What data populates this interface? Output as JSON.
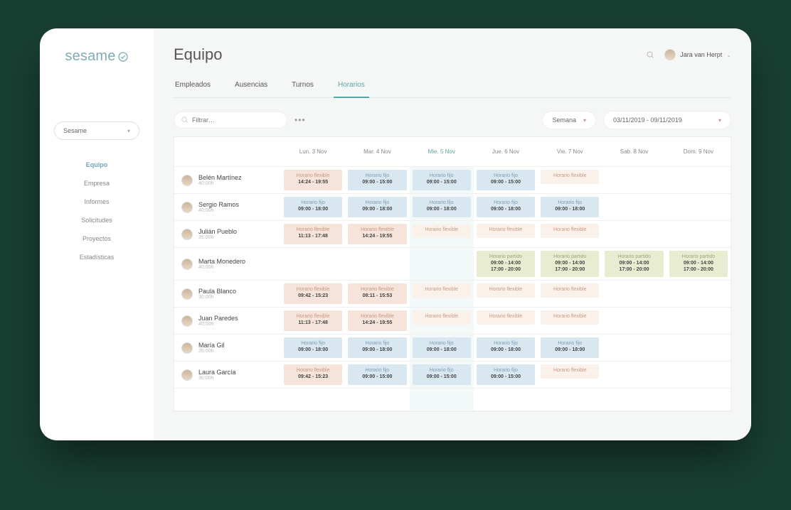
{
  "brand": "sesame",
  "org_select": {
    "label": "Sesame"
  },
  "nav": [
    {
      "label": "Equipo",
      "active": true
    },
    {
      "label": "Empresa"
    },
    {
      "label": "Informes"
    },
    {
      "label": "Solicitudes"
    },
    {
      "label": "Proyectos"
    },
    {
      "label": "Estadísticas"
    }
  ],
  "header": {
    "title": "Equipo",
    "user_name": "Jara van Herpt"
  },
  "tabs": [
    {
      "label": "Empleados"
    },
    {
      "label": "Ausencias"
    },
    {
      "label": "Turnos"
    },
    {
      "label": "Horarios",
      "active": true
    }
  ],
  "filter": {
    "placeholder": "Filtrar…"
  },
  "view_select": {
    "label": "Semana"
  },
  "date_range": {
    "label": "03/11/2019 - 09/11/2019"
  },
  "days": [
    {
      "label": "Lun. 3 Nov"
    },
    {
      "label": "Mar. 4 Nov"
    },
    {
      "label": "Mie. 5 Nov",
      "today": true
    },
    {
      "label": "Jue. 6 Nov"
    },
    {
      "label": "Vie. 7 Nov"
    },
    {
      "label": "Sab. 8 Nov"
    },
    {
      "label": "Dom. 9 Nov"
    }
  ],
  "shift_labels": {
    "flexible": "Horario flexible",
    "fijo": "Horario fijo",
    "partido": "Horario partido"
  },
  "employees": [
    {
      "name": "Belén Martínez",
      "sub": "40:00h",
      "cells": [
        {
          "type": "flexible",
          "time": "14:24 - 19:55"
        },
        {
          "type": "fijo",
          "time": "09:00 - 15:00"
        },
        {
          "type": "fijo",
          "time": "09:00 - 15:00"
        },
        {
          "type": "fijo",
          "time": "09:00 - 15:00"
        },
        {
          "type": "flexible",
          "light": true,
          "time": ""
        },
        null,
        null
      ]
    },
    {
      "name": "Sergio Ramos",
      "sub": "40:00h",
      "cells": [
        {
          "type": "fijo",
          "time": "09:00 - 18:00"
        },
        {
          "type": "fijo",
          "time": "09:00 - 18:00"
        },
        {
          "type": "fijo",
          "time": "09:00 - 18:00"
        },
        {
          "type": "fijo",
          "time": "09:00 - 18:00"
        },
        {
          "type": "fijo",
          "time": "09:00 - 18:00"
        },
        null,
        null
      ]
    },
    {
      "name": "Julián Pueblo",
      "sub": "35:00h",
      "cells": [
        {
          "type": "flexible",
          "time": "11:13 - 17:48"
        },
        {
          "type": "flexible",
          "time": "14:24 - 19:55"
        },
        {
          "type": "flexible",
          "light": true,
          "time": ""
        },
        {
          "type": "flexible",
          "light": true,
          "time": ""
        },
        {
          "type": "flexible",
          "light": true,
          "time": ""
        },
        null,
        null
      ]
    },
    {
      "name": "Marta Monedero",
      "sub": "40:00h",
      "cells": [
        null,
        null,
        null,
        {
          "type": "partido",
          "time": "09:00 - 14:00",
          "time2": "17:00 - 20:00"
        },
        {
          "type": "partido",
          "time": "09:00 - 14:00",
          "time2": "17:00 - 20:00"
        },
        {
          "type": "partido",
          "time": "09:00 - 14:00",
          "time2": "17:00 - 20:00"
        },
        {
          "type": "partido",
          "time": "09:00 - 14:00",
          "time2": "17:00 - 20:00"
        }
      ]
    },
    {
      "name": "Paula Blanco",
      "sub": "30:00h",
      "cells": [
        {
          "type": "flexible",
          "time": "09:42 - 15:23"
        },
        {
          "type": "flexible",
          "time": "08:11 - 15:53"
        },
        {
          "type": "flexible",
          "light": true,
          "time": ""
        },
        {
          "type": "flexible",
          "light": true,
          "time": ""
        },
        {
          "type": "flexible",
          "light": true,
          "time": ""
        },
        null,
        null
      ]
    },
    {
      "name": "Juan Paredes",
      "sub": "40:00h",
      "cells": [
        {
          "type": "flexible",
          "time": "11:13 - 17:48"
        },
        {
          "type": "flexible",
          "time": "14:24 - 19:55"
        },
        {
          "type": "flexible",
          "light": true,
          "time": ""
        },
        {
          "type": "flexible",
          "light": true,
          "time": ""
        },
        {
          "type": "flexible",
          "light": true,
          "time": ""
        },
        null,
        null
      ]
    },
    {
      "name": "María Gil",
      "sub": "35:00h",
      "cells": [
        {
          "type": "fijo",
          "time": "09:00 - 18:00"
        },
        {
          "type": "fijo",
          "time": "09:00 - 18:00"
        },
        {
          "type": "fijo",
          "time": "09:00 - 18:00"
        },
        {
          "type": "fijo",
          "time": "09:00 - 18:00"
        },
        {
          "type": "fijo",
          "time": "09:00 - 18:00"
        },
        null,
        null
      ]
    },
    {
      "name": "Laura García",
      "sub": "30:00h",
      "cells": [
        {
          "type": "flexible",
          "time": "09:42 - 15:23"
        },
        {
          "type": "fijo",
          "time": "09:00 - 15:00"
        },
        {
          "type": "fijo",
          "time": "09:00 - 15:00"
        },
        {
          "type": "fijo",
          "time": "09:00 - 15:00"
        },
        {
          "type": "flexible",
          "light": true,
          "time": ""
        },
        null,
        null
      ]
    }
  ]
}
